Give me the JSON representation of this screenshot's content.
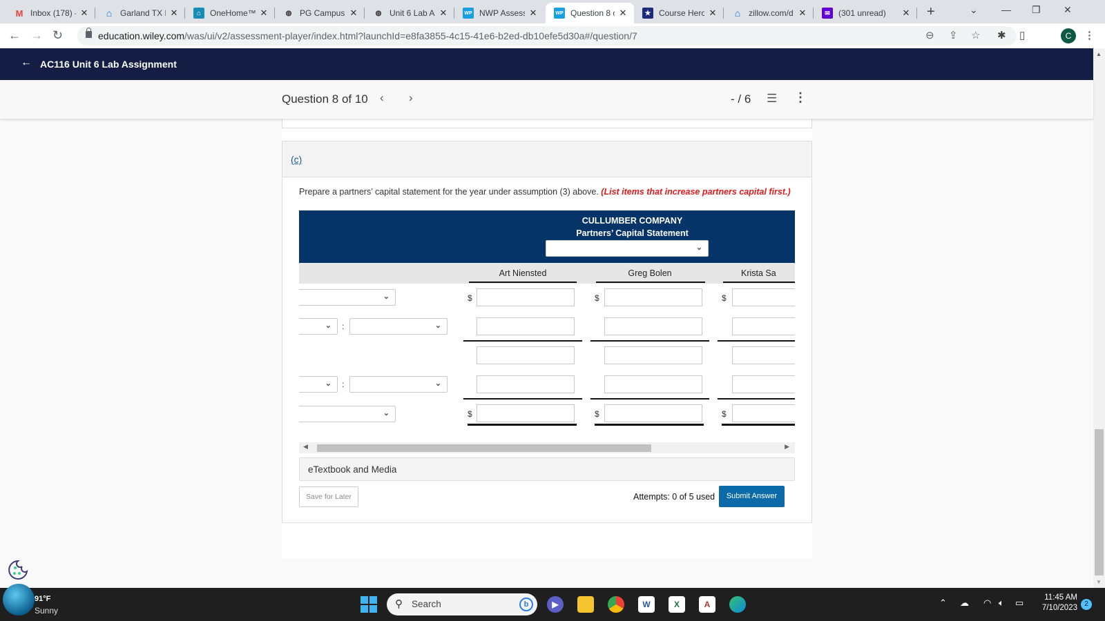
{
  "browser": {
    "tabs": [
      {
        "label": "Inbox (178) -",
        "icon": "gmail-icon",
        "active": false
      },
      {
        "label": "Garland TX R",
        "icon": "zillow-icon",
        "active": false
      },
      {
        "label": "OneHome™",
        "icon": "onehome-icon",
        "active": false
      },
      {
        "label": "PG Campus",
        "icon": "pg-campus-icon",
        "active": false
      },
      {
        "label": "Unit 6 Lab As",
        "icon": "pg-campus-icon",
        "active": false
      },
      {
        "label": "NWP Assessm",
        "icon": "wp-icon",
        "active": false
      },
      {
        "label": "Question 8 o",
        "icon": "wp-icon",
        "active": true
      },
      {
        "label": "Course Hero",
        "icon": "course-hero-icon",
        "active": false
      },
      {
        "label": "zillow.com/d",
        "icon": "zillow-icon",
        "active": false
      },
      {
        "label": "(301 unread)",
        "icon": "yahoo-mail-icon",
        "active": false
      }
    ],
    "url_host": "education.wiley.com",
    "url_path": "/was/ui/v2/assessment-player/index.html?launchId=e8fa3855-4c15-41e6-b2ed-db10efe5d30a#/question/7",
    "profile_initial": "C"
  },
  "app": {
    "assignment_title": "AC116 Unit 6 Lab Assignment",
    "question_label": "Question 8 of 10",
    "score": "- / 6"
  },
  "question": {
    "part_label": "(c)",
    "instruction": "Prepare a partners’ capital statement for the year under assumption (3) above.",
    "instruction_note": "(List items that increase partners capital first.)",
    "statement": {
      "company": "CULLUMBER COMPANY",
      "title": "Partners’ Capital Statement",
      "period_select": "",
      "partners": [
        "Art Niensted",
        "Greg Bolen",
        "Krista Sa"
      ],
      "currency_symbol": "$",
      "colon": ":"
    },
    "etextbook_label": "eTextbook and Media",
    "save_label": "Save for Later",
    "attempts": "Attempts: 0 of 5 used",
    "submit_label": "Submit Answer"
  },
  "colors": {
    "app_header": "#141e44",
    "statement_header": "#053468",
    "submit": "#0b6ba8",
    "instruction_note": "#e01b1b"
  },
  "taskbar": {
    "temperature": "91°F",
    "condition": "Sunny",
    "search_label": "Search",
    "time": "11:45 AM",
    "date": "7/10/2023",
    "notification_count": "2"
  }
}
